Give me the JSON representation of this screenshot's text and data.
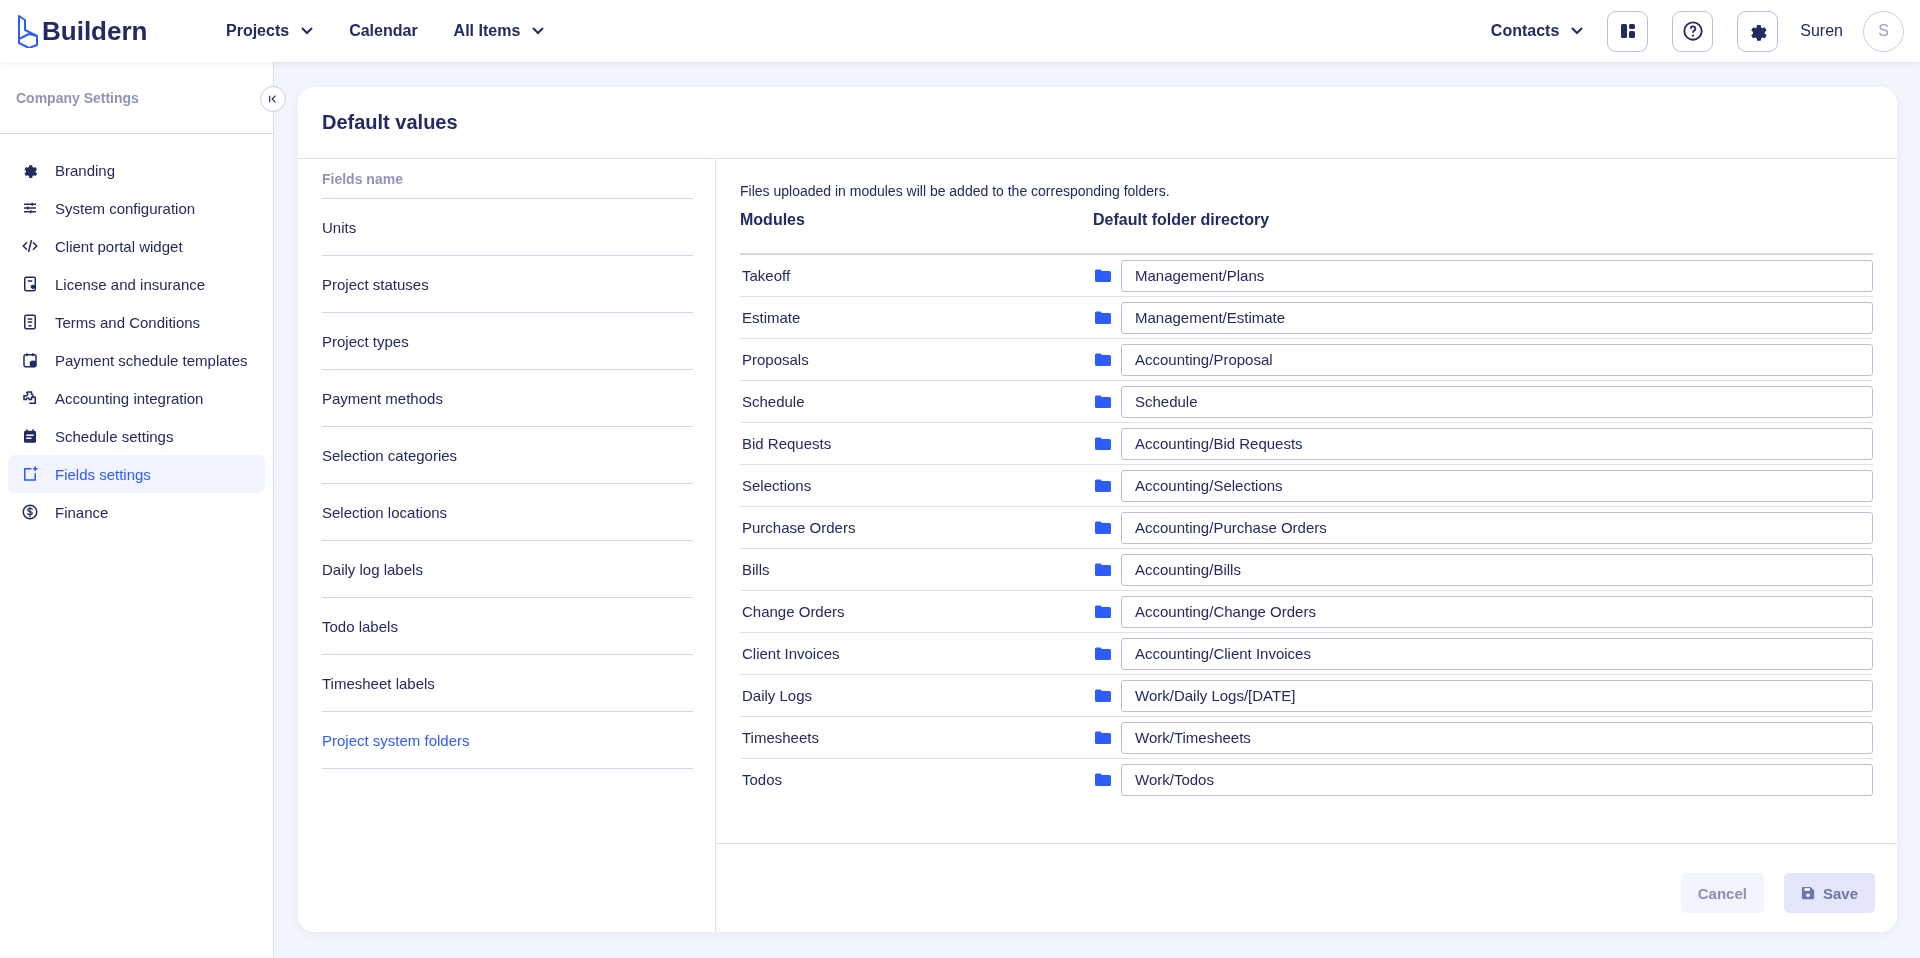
{
  "header": {
    "logo": "Buildern",
    "nav": [
      {
        "label": "Projects",
        "dropdown": true
      },
      {
        "label": "Calendar",
        "dropdown": false
      },
      {
        "label": "All Items",
        "dropdown": true
      }
    ],
    "contacts": {
      "label": "Contacts",
      "dropdown": true
    },
    "user": {
      "name": "Suren",
      "initial": "S"
    }
  },
  "sidebar": {
    "title": "Company Settings",
    "items": [
      {
        "label": "Branding",
        "selected": false
      },
      {
        "label": "System configuration",
        "selected": false
      },
      {
        "label": "Client portal widget",
        "selected": false
      },
      {
        "label": "License and insurance",
        "selected": false
      },
      {
        "label": "Terms and Conditions",
        "selected": false
      },
      {
        "label": "Payment schedule templates",
        "selected": false
      },
      {
        "label": "Accounting integration",
        "selected": false
      },
      {
        "label": "Schedule settings",
        "selected": false
      },
      {
        "label": "Fields settings",
        "selected": true
      },
      {
        "label": "Finance",
        "selected": false
      }
    ]
  },
  "card": {
    "title": "Default values",
    "fields_header": "Fields name",
    "fields": [
      {
        "label": "Units",
        "selected": false
      },
      {
        "label": "Project statuses",
        "selected": false
      },
      {
        "label": "Project types",
        "selected": false
      },
      {
        "label": "Payment methods",
        "selected": false
      },
      {
        "label": "Selection categories",
        "selected": false
      },
      {
        "label": "Selection locations",
        "selected": false
      },
      {
        "label": "Daily log labels",
        "selected": false
      },
      {
        "label": "Todo labels",
        "selected": false
      },
      {
        "label": "Timesheet labels",
        "selected": false
      },
      {
        "label": "Project system folders",
        "selected": true
      }
    ],
    "note": "Files uploaded in modules will be added to the corresponding folders.",
    "columns": [
      "Modules",
      "Default folder directory"
    ],
    "rows": [
      {
        "module": "Takeoff",
        "folder": "Management/Plans"
      },
      {
        "module": "Estimate",
        "folder": "Management/Estimate"
      },
      {
        "module": "Proposals",
        "folder": "Accounting/Proposal"
      },
      {
        "module": "Schedule",
        "folder": "Schedule"
      },
      {
        "module": "Bid Requests",
        "folder": "Accounting/Bid Requests"
      },
      {
        "module": "Selections",
        "folder": "Accounting/Selections"
      },
      {
        "module": "Purchase Orders",
        "folder": "Accounting/Purchase Orders"
      },
      {
        "module": "Bills",
        "folder": "Accounting/Bills"
      },
      {
        "module": "Change Orders",
        "folder": "Accounting/Change Orders"
      },
      {
        "module": "Client Invoices",
        "folder": "Accounting/Client Invoices"
      },
      {
        "module": "Daily Logs",
        "folder": "Work/Daily Logs/[DATE]"
      },
      {
        "module": "Timesheets",
        "folder": "Work/Timesheets"
      },
      {
        "module": "Todos",
        "folder": "Work/Todos"
      }
    ],
    "buttons": [
      {
        "label": "Cancel",
        "kind": "cancel",
        "disabled": true
      },
      {
        "label": "Save",
        "kind": "save",
        "disabled": true
      }
    ]
  }
}
